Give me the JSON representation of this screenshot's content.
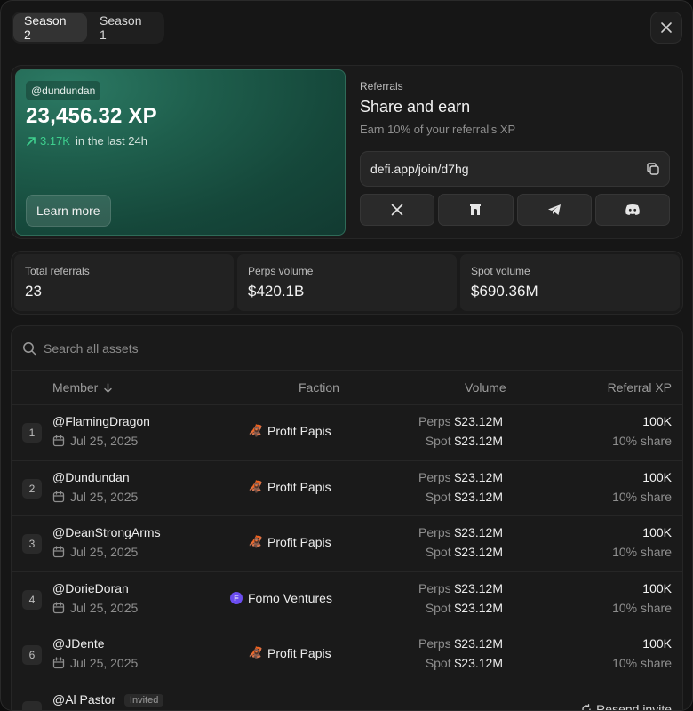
{
  "tabs": [
    {
      "label": "Season 2",
      "active": true
    },
    {
      "label": "Season 1",
      "active": false
    }
  ],
  "xp_card": {
    "handle": "@dundundan",
    "xp": "23,456.32 XP",
    "delta": "3.17K",
    "delta_period": "in the last 24h",
    "learn_more": "Learn more"
  },
  "referrals": {
    "label": "Referrals",
    "title": "Share and earn",
    "subtitle": "Earn 10% of your referral's XP",
    "link": "defi.app/join/d7hg",
    "share_icons": [
      "x-icon",
      "farcaster-icon",
      "telegram-icon",
      "discord-icon"
    ]
  },
  "stats": [
    {
      "label": "Total referrals",
      "value": "23"
    },
    {
      "label": "Perps volume",
      "value": "$420.1B"
    },
    {
      "label": "Spot volume",
      "value": "$690.36M"
    }
  ],
  "search": {
    "placeholder": "Search all assets"
  },
  "table": {
    "headers": {
      "member": "Member",
      "faction": "Faction",
      "volume": "Volume",
      "xp": "Referral XP"
    },
    "perps_label": "Perps",
    "spot_label": "Spot",
    "rows": [
      {
        "rank": "1",
        "member": "@FlamingDragon",
        "date": "Jul 25, 2025",
        "faction": "Profit Papis",
        "perps": "$23.12M",
        "spot": "$23.12M",
        "xp": "100K",
        "share": "10% share"
      },
      {
        "rank": "2",
        "member": "@Dundundan",
        "date": "Jul 25, 2025",
        "faction": "Profit Papis",
        "perps": "$23.12M",
        "spot": "$23.12M",
        "xp": "100K",
        "share": "10% share"
      },
      {
        "rank": "3",
        "member": "@DeanStrongArms",
        "date": "Jul 25, 2025",
        "faction": "Profit Papis",
        "perps": "$23.12M",
        "spot": "$23.12M",
        "xp": "100K",
        "share": "10% share"
      },
      {
        "rank": "4",
        "member": "@DorieDoran",
        "date": "Jul 25, 2025",
        "faction": "Fomo Ventures",
        "perps": "$23.12M",
        "spot": "$23.12M",
        "xp": "100K",
        "share": "10% share"
      },
      {
        "rank": "6",
        "member": "@JDente",
        "date": "Jul 25, 2025",
        "faction": "Profit Papis",
        "perps": "$23.12M",
        "spot": "$23.12M",
        "xp": "100K",
        "share": "10% share"
      }
    ],
    "invited_row": {
      "rank": "-",
      "member": "@Al Pastor",
      "badge": "Invited",
      "action": "Resend invite"
    }
  },
  "colors": {
    "accent_green": "#3ecf8e",
    "fomo_purple": "#6b4df0"
  }
}
